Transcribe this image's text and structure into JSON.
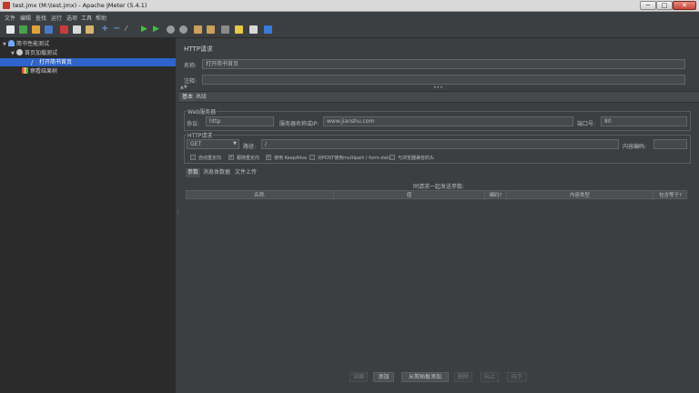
{
  "window": {
    "title": "test.jmx (M:\\test.jmx) - Apache JMeter (5.4.1)",
    "min": "─",
    "max": "□",
    "close": "✕"
  },
  "menu": [
    "文件",
    "编辑",
    "查找",
    "运行",
    "选项",
    "工具",
    "帮助"
  ],
  "toolbar": {
    "icons": [
      "new-icon",
      "templates-icon",
      "open-icon",
      "save-icon",
      "cut-icon",
      "copy-icon",
      "paste-icon",
      "expand-icon",
      "collapse-icon",
      "toggle-icon",
      "start-icon",
      "start-no-pause-icon",
      "stop-icon",
      "shutdown-icon",
      "clear-icon",
      "clear-all-icon",
      "search-icon",
      "reset-search-icon",
      "function-helper-icon",
      "help-icon"
    ]
  },
  "tree": {
    "items": [
      {
        "label": "简书性能测试",
        "level": 0
      },
      {
        "label": "首页加载测试",
        "level": 1
      },
      {
        "label": "打开简书首页",
        "level": 2,
        "selected": true
      },
      {
        "label": "察看结果树",
        "level": 1
      }
    ]
  },
  "panel": {
    "title": "HTTP请求",
    "name_label": "名称:",
    "name_value": "打开简书首页",
    "comment_label": "注释:",
    "comment_value": "",
    "config_tabs": [
      "基本",
      "高级"
    ],
    "web_server": {
      "legend": "Web服务器",
      "protocol_label": "协议:",
      "protocol_value": "http",
      "server_label": "服务器名称或IP:",
      "server_value": "www.jianshu.com",
      "port_label": "端口号:",
      "port_value": "80"
    },
    "http_request": {
      "legend": "HTTP请求",
      "method_value": "GET",
      "path_label": "路径:",
      "path_value": "/",
      "encoding_label": "内容编码:",
      "encoding_value": ""
    },
    "options": [
      {
        "label": "自动重定向",
        "checked": false
      },
      {
        "label": "跟随重定向",
        "checked": true
      },
      {
        "label": "使用 KeepAlive",
        "checked": true
      },
      {
        "label": "对POST使用multipart / form-data",
        "checked": false
      },
      {
        "label": "与浏览器兼容的头",
        "checked": false
      }
    ],
    "param_tabs": [
      "参数",
      "消息体数据",
      "文件上传"
    ],
    "table_caption": "同请求一起发送参数:",
    "table_headers": [
      "名称:",
      "值",
      "编码?",
      "内容类型",
      "包含等于?"
    ],
    "buttons": [
      {
        "label": "详细",
        "enabled": false
      },
      {
        "label": "添加",
        "enabled": true
      },
      {
        "label": "从剪贴板添加",
        "enabled": true
      },
      {
        "label": "删除",
        "enabled": false
      },
      {
        "label": "向上",
        "enabled": false
      },
      {
        "label": "向下",
        "enabled": false
      }
    ]
  }
}
